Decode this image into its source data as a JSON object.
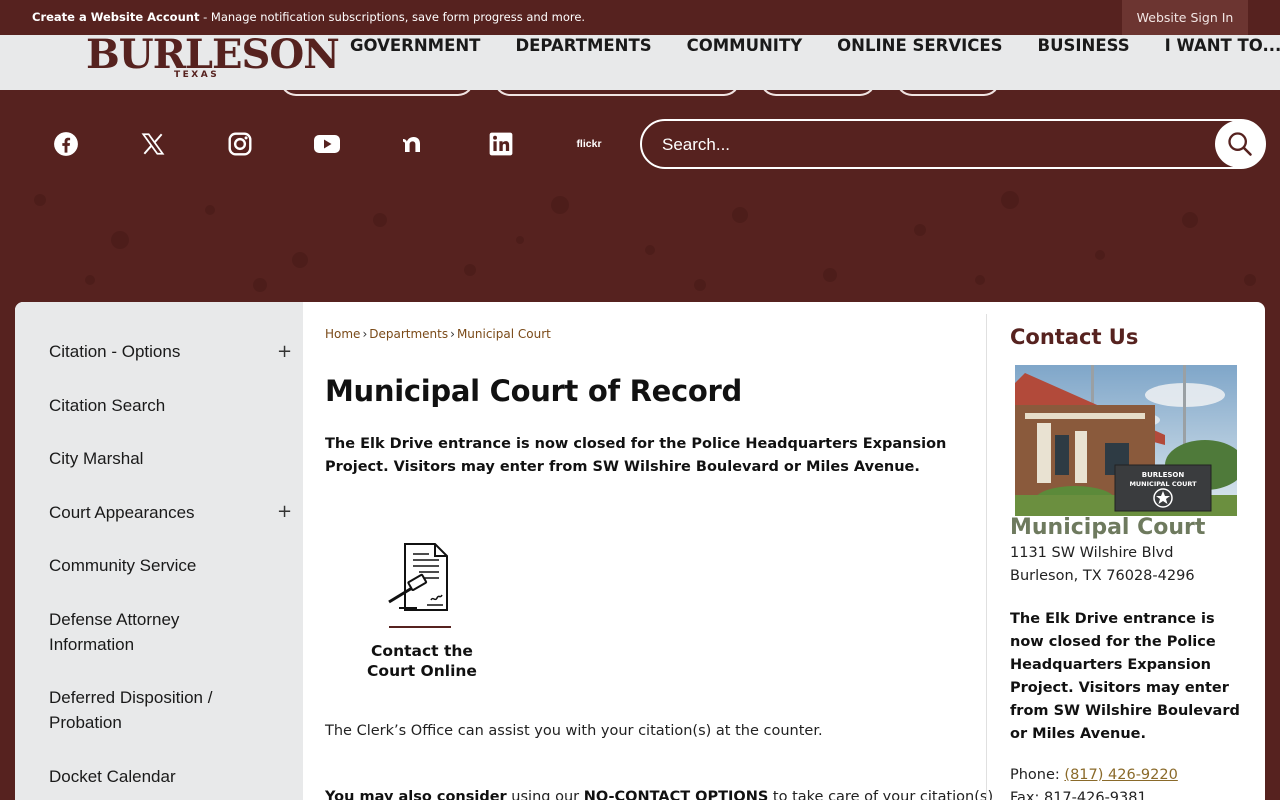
{
  "topbar": {
    "account_link": "Create a Website Account",
    "account_message": " - Manage notification subscriptions, save form progress and more.",
    "sign_in": "Website Sign In"
  },
  "logo": {
    "name": "BURLESON",
    "state": "TEXAS"
  },
  "nav": [
    "GOVERNMENT",
    "DEPARTMENTS",
    "COMMUNITY",
    "ONLINE SERVICES",
    "BUSINESS",
    "I WANT TO..."
  ],
  "social": {
    "icons": [
      "facebook-icon",
      "x-icon",
      "instagram-icon",
      "youtube-icon",
      "nextdoor-icon",
      "linkedin-icon",
      "flickr-icon"
    ],
    "flickr_label": "flickr"
  },
  "search": {
    "placeholder": "Search..."
  },
  "sidebar": {
    "items": [
      {
        "label": "Citation - Options",
        "expandable": true
      },
      {
        "label": "Citation Search",
        "expandable": false
      },
      {
        "label": "City Marshal",
        "expandable": false
      },
      {
        "label": "Court Appearances",
        "expandable": true
      },
      {
        "label": "Community Service",
        "expandable": false
      },
      {
        "label": "Defense Attorney Information",
        "expandable": false
      },
      {
        "label": "Deferred Disposition / Probation",
        "expandable": false
      },
      {
        "label": "Docket Calendar",
        "expandable": false
      }
    ],
    "expand_symbol": "+"
  },
  "breadcrumb": [
    "Home",
    "Departments",
    "Municipal Court"
  ],
  "breadcrumb_separator": "›",
  "main": {
    "title": "Municipal Court of Record",
    "notice": "The Elk Drive entrance is now closed for the Police Headquarters Expansion Project. Visitors may enter from SW Wilshire Boulevard or Miles Avenue.",
    "tile_label": "Contact the Court Online",
    "clerk_text": "The Clerk’s Office can assist you with your citation(s) at the counter.",
    "noncontact": {
      "lead": "You may also consider",
      "middle": " using our ",
      "options": "NO-CONTACT OPTIONS",
      "tail": " to take care of your citation(s)"
    }
  },
  "contact": {
    "heading": "Contact Us",
    "photo_sign_line1": "BURLESON",
    "photo_sign_line2": "MUNICIPAL COURT",
    "name": "Municipal Court",
    "address_line1": "1131 SW Wilshire Blvd",
    "address_line2": "Burleson, TX 76028-4296",
    "notice": "The Elk Drive entrance is now closed for the Police Headquarters Expansion Project. Visitors may enter from SW Wilshire Boulevard or Miles Avenue.",
    "phone_label": "Phone: ",
    "phone": "(817) 426-9220",
    "fax_label": "Fax: ",
    "fax": "817-426-9381"
  },
  "colors": {
    "brand": "#56221f",
    "header_bg": "#e8e9ea",
    "link": "#7a4a18",
    "court_name": "#6e7a5e"
  }
}
